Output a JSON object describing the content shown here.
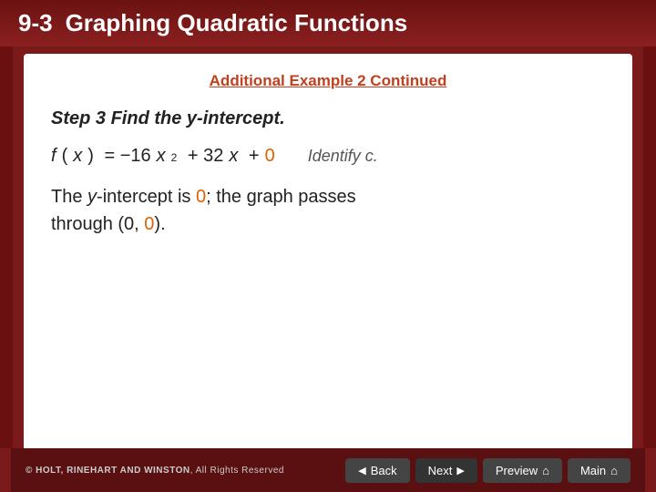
{
  "header": {
    "number": "9-3",
    "title": "Graphing Quadratic Functions"
  },
  "content": {
    "subtitle": "Additional Example 2 Continued",
    "step_heading": "Step 3",
    "step_desc": "Find the y-intercept.",
    "equation": "f(x) = −16x² + 32x + 0",
    "identify_label": "Identify c.",
    "result_line1": "The y-intercept is 0; the graph passes",
    "result_line2": "through (0, 0)."
  },
  "footer": {
    "copyright": "© HOLT, RINEHART AND WINSTON, All Rights Reserved",
    "buttons": {
      "back": "Back",
      "next": "Next",
      "preview": "Preview",
      "main": "Main"
    }
  }
}
